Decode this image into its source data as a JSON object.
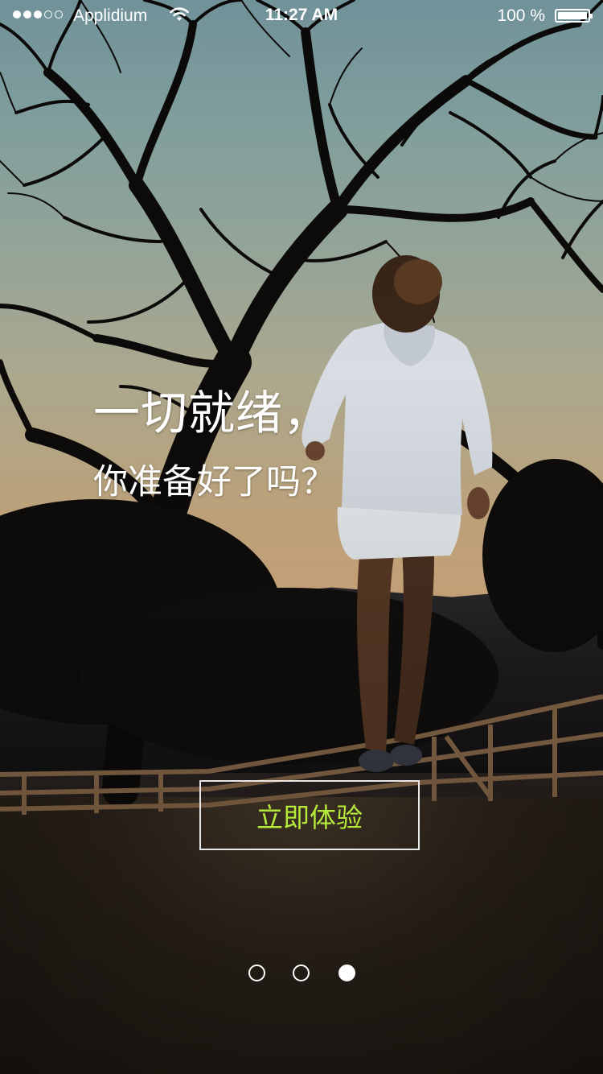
{
  "status_bar": {
    "signal_dots": [
      true,
      true,
      true,
      false,
      false
    ],
    "carrier": "Applidium",
    "time": "11:27 AM",
    "battery_text": "100 %",
    "battery_level": 1.0
  },
  "headline": {
    "line1": "一切就绪，",
    "line2": "你准备好了吗？"
  },
  "cta": {
    "label": "立即体验",
    "label_color": "#b5ea3a"
  },
  "pager": {
    "total": 3,
    "active_index": 2
  },
  "icons": {
    "wifi": "wifi-icon",
    "battery": "battery-icon"
  }
}
